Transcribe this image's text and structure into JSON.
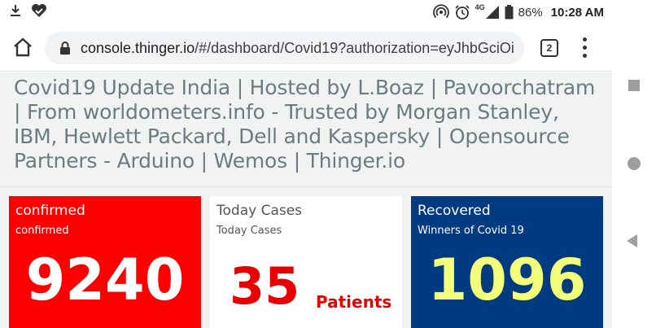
{
  "status_bar": {
    "battery": "86%",
    "time": "10:28 AM",
    "network": "4G"
  },
  "browser": {
    "url_domain": "console.thinger.io",
    "url_path": "/#/dashboard/Covid19?authorization=eyJhbGciOi",
    "tab_count": "2"
  },
  "dashboard": {
    "title": "Covid19 Update India | Hosted by L.Boaz | Pavoorchatram | From worldometers.info - Trusted by Morgan Stanley, IBM, Hewlett Packard, Dell and Kaspersky | Opensource Partners - Arduino | Wemos | Thinger.io",
    "widgets": [
      {
        "title": "confirmed",
        "subtitle": "confirmed",
        "value": "9240",
        "color": "#ff0000"
      },
      {
        "title": "Today Cases",
        "subtitle": "Today Cases",
        "value": "35",
        "unit": "Patients",
        "color": "#ffffff"
      },
      {
        "title": "Recovered",
        "subtitle": "Winners of Covid 19",
        "value": "1096",
        "color": "#003a80"
      }
    ]
  },
  "icons": {
    "status_left": [
      "download-icon",
      "heart-check-icon"
    ],
    "status_right": [
      "hotspot-icon",
      "alarm-icon",
      "signal-icon",
      "battery-icon"
    ],
    "browser": [
      "home-icon",
      "lock-icon",
      "tabs-icon",
      "more-vert-icon"
    ],
    "nav": [
      "recents-icon",
      "home-circle-icon",
      "back-icon"
    ]
  }
}
